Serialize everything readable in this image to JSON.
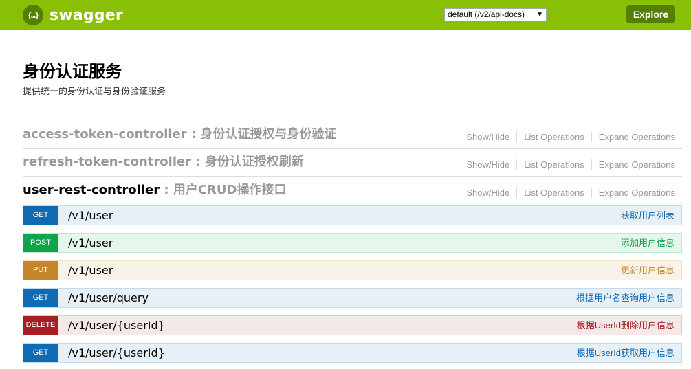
{
  "header": {
    "logo_icon": "{…}",
    "logo_text": "swagger",
    "api_select_value": "default (/v2/api-docs)",
    "explore_label": "Explore",
    "brand_color": "#89bf04"
  },
  "info": {
    "title": "身份认证服务",
    "description": "提供统一的身份认证与身份验证服务"
  },
  "resource_actions": {
    "show_hide": "Show/Hide",
    "list_operations": "List Operations",
    "expand_operations": "Expand Operations"
  },
  "resources": [
    {
      "name": "access-token-controller",
      "description": " : 身份认证授权与身份验证"
    },
    {
      "name": "refresh-token-controller",
      "description": " : 身份认证授权刷新"
    },
    {
      "name": "user-rest-controller",
      "description": " : 用户CRUD操作接口"
    }
  ],
  "operations": [
    {
      "method": "GET",
      "path": "/v1/user",
      "summary": "获取用户列表"
    },
    {
      "method": "POST",
      "path": "/v1/user",
      "summary": "添加用户信息"
    },
    {
      "method": "PUT",
      "path": "/v1/user",
      "summary": "更新用户信息"
    },
    {
      "method": "GET",
      "path": "/v1/user/query",
      "summary": "根据用户名查询用户信息"
    },
    {
      "method": "DELETE",
      "path": "/v1/user/{userId}",
      "summary": "根据UserId删除用户信息"
    },
    {
      "method": "GET",
      "path": "/v1/user/{userId}",
      "summary": "根据UserId获取用户信息"
    }
  ]
}
